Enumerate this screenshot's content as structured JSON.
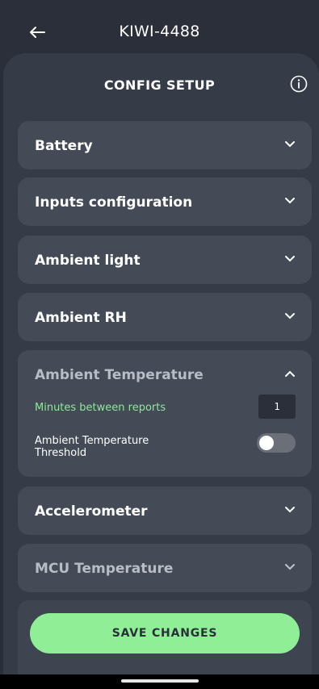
{
  "header": {
    "device_name": "KIWI-4488"
  },
  "panel": {
    "title": "CONFIG SETUP"
  },
  "sections": [
    {
      "label": "Battery",
      "expanded": false
    },
    {
      "label": "Inputs configuration",
      "expanded": false
    },
    {
      "label": "Ambient light",
      "expanded": false
    },
    {
      "label": "Ambient RH",
      "expanded": false
    },
    {
      "label": "Ambient Temperature",
      "expanded": true,
      "minutes_label": "Minutes between reports",
      "minutes_value": "1",
      "threshold_label_line1": "Ambient Temperature",
      "threshold_label_line2": "Threshold",
      "threshold_enabled": false
    },
    {
      "label": "Accelerometer",
      "expanded": false
    },
    {
      "label": "MCU Temperature",
      "expanded": false
    }
  ],
  "actions": {
    "save_label": "SAVE CHANGES"
  },
  "colors": {
    "background": "#2b2f3a",
    "panel": "#353b47",
    "card": "#444b57",
    "accent_green": "#90ee97",
    "label_green": "#8ee79a"
  }
}
